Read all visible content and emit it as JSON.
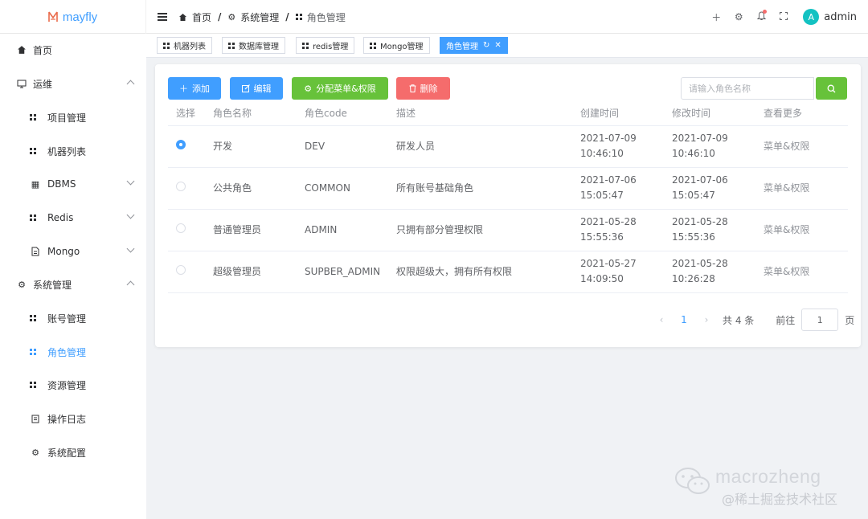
{
  "app": {
    "name": "mayfly"
  },
  "header": {
    "breadcrumb": [
      "首页",
      "系统管理",
      "角色管理"
    ],
    "user": {
      "avatar_letter": "A",
      "name": "admin"
    }
  },
  "sidebar": {
    "items": [
      {
        "label": "首页"
      },
      {
        "label": "运维"
      },
      {
        "label": "项目管理"
      },
      {
        "label": "机器列表"
      },
      {
        "label": "DBMS"
      },
      {
        "label": "Redis"
      },
      {
        "label": "Mongo"
      },
      {
        "label": "系统管理"
      },
      {
        "label": "账号管理"
      },
      {
        "label": "角色管理"
      },
      {
        "label": "资源管理"
      },
      {
        "label": "操作日志"
      },
      {
        "label": "系统配置"
      }
    ]
  },
  "tags": [
    {
      "label": "机器列表"
    },
    {
      "label": "数据库管理"
    },
    {
      "label": "redis管理"
    },
    {
      "label": "Mongo管理"
    },
    {
      "label": "角色管理"
    }
  ],
  "toolbar": {
    "add_label": "添加",
    "edit_label": "编辑",
    "assign_label": "分配菜单&权限",
    "delete_label": "删除",
    "search_placeholder": "请输入角色名称"
  },
  "table": {
    "columns": [
      "选择",
      "角色名称",
      "角色code",
      "描述",
      "创建时间",
      "修改时间",
      "查看更多"
    ],
    "rows": [
      {
        "name": "开发",
        "code": "DEV",
        "desc": "研发人员",
        "created": "2021-07-09 10:46:10",
        "modified": "2021-07-09 10:46:10",
        "more": "菜单&权限",
        "selected": true
      },
      {
        "name": "公共角色",
        "code": "COMMON",
        "desc": "所有账号基础角色",
        "created": "2021-07-06 15:05:47",
        "modified": "2021-07-06 15:05:47",
        "more": "菜单&权限",
        "selected": false
      },
      {
        "name": "普通管理员",
        "code": "ADMIN",
        "desc": "只拥有部分管理权限",
        "created": "2021-05-28 15:55:36",
        "modified": "2021-05-28 15:55:36",
        "more": "菜单&权限",
        "selected": false
      },
      {
        "name": "超级管理员",
        "code": "SUPBER_ADMIN",
        "desc": "权限超级大，拥有所有权限",
        "created": "2021-05-27 14:09:50",
        "modified": "2021-05-28 10:26:28",
        "more": "菜单&权限",
        "selected": false
      }
    ]
  },
  "pagination": {
    "current_page": "1",
    "total": "共 4 条",
    "goto_label": "前往",
    "jump_value": "1",
    "page_suffix": "页"
  },
  "watermark": {
    "line1": "macrozheng",
    "line2": "@稀土掘金技术社区"
  },
  "colors": {
    "primary": "#409eff",
    "success": "#67c23a",
    "danger": "#f56c6c",
    "avatar": "#13c2c2"
  }
}
